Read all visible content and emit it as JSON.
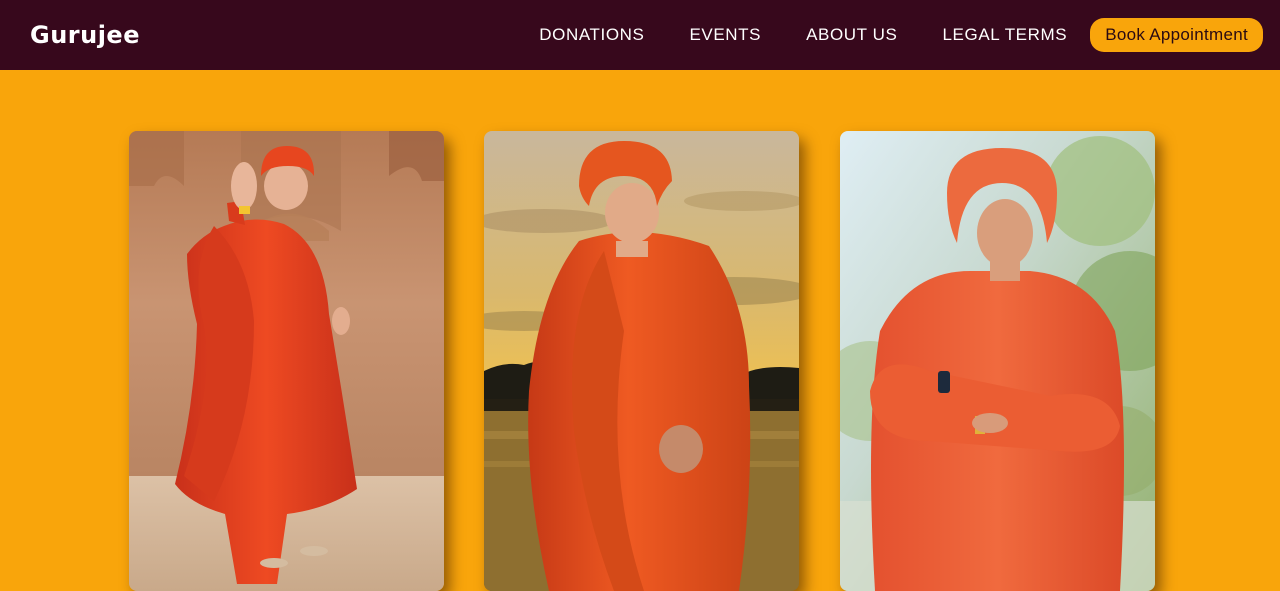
{
  "brand": {
    "name": "Gurujee"
  },
  "nav": {
    "links": [
      {
        "label": "DONATIONS"
      },
      {
        "label": "EVENTS"
      },
      {
        "label": "ABOUT US"
      },
      {
        "label": "LEGAL TERMS"
      }
    ],
    "cta_label": "Book Appointment"
  },
  "colors": {
    "navbar_bg": "#37081c",
    "page_bg": "#f9a50b",
    "accent": "#f9a50b",
    "robe": "#e8421b"
  },
  "gallery": {
    "images": [
      {
        "subject": "guru in saffron robes raising right hand in blessing, stone arch backdrop"
      },
      {
        "subject": "guru in saffron robe and turban, hands folded, golden sunset over lake"
      },
      {
        "subject": "guru in saffron robe and turban, arms crossed, garden backdrop"
      }
    ]
  }
}
